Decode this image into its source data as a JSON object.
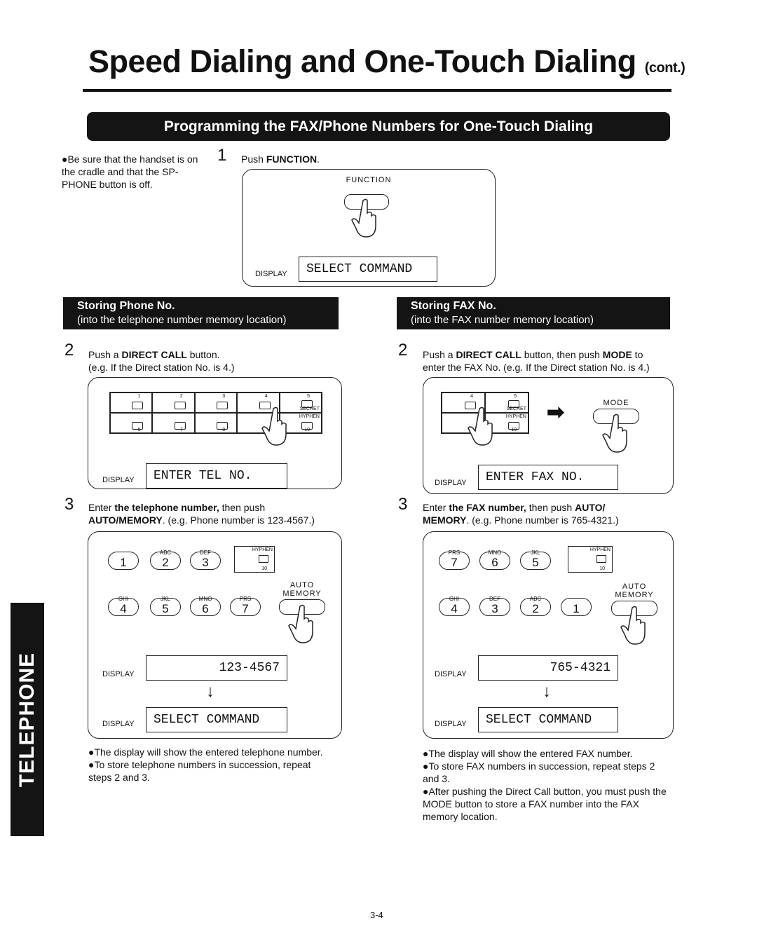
{
  "title": {
    "main": "Speed Dialing and One-Touch Dialing",
    "suffix": "(cont.)"
  },
  "banner": "Programming the FAX/Phone Numbers for One-Touch Dialing",
  "note": "●Be sure that the handset is on the cradle and that the SP-PHONE button is off.",
  "step1": {
    "number": "1",
    "text_pre": "Push ",
    "text_bold": "FUNCTION",
    "text_post": ".",
    "button_label": "FUNCTION",
    "display_label": "DISPLAY",
    "display": "SELECT COMMAND"
  },
  "phone": {
    "header_title": "Storing Phone No.",
    "header_sub": "(into the telephone number memory location)",
    "step2": {
      "number": "2",
      "line1_pre": "Push a ",
      "line1_bold": "DIRECT CALL",
      "line1_post": " button.",
      "line2": "(e.g. If the Direct station No. is 4.)",
      "display": "ENTER TEL NO."
    },
    "step3": {
      "number": "3",
      "line1_pre": "Enter ",
      "line1_bold": "the telephone number,",
      "line1_post": " then push",
      "line2_bold": "AUTO/MEMORY",
      "line2_post": ". (e.g. Phone number is 123-4567.)",
      "display1": "123-4567",
      "display2": "SELECT COMMAND"
    },
    "notes": [
      "●The display will show the entered telephone number.",
      "●To store telephone numbers in succession, repeat steps 2 and 3."
    ]
  },
  "fax": {
    "header_title": "Storing FAX No.",
    "header_sub": "(into the FAX number memory location)",
    "step2": {
      "number": "2",
      "line1_pre": "Push a ",
      "line1_bold": "DIRECT CALL",
      "line1_mid": " button, then push ",
      "line1_bold2": "MODE",
      "line1_post": " to",
      "line2": "enter the FAX No. (e.g. If the Direct station No. is 4.)",
      "mode_label": "MODE",
      "display": "ENTER FAX NO."
    },
    "step3": {
      "number": "3",
      "line1_pre": "Enter ",
      "line1_bold": "the FAX number,",
      "line1_post": " then push ",
      "line1_bold2": "AUTO/",
      "line2_bold": "MEMORY",
      "line2_post": ". (e.g. Phone number is 765-4321.)",
      "display1": "765-4321",
      "display2": "SELECT COMMAND"
    },
    "notes": [
      "●The display will show the entered FAX number.",
      "●To store FAX numbers in succession, repeat steps 2 and 3.",
      "●After pushing the Direct Call button, you must push the MODE button to store a FAX number into the FAX memory location."
    ]
  },
  "display_label": "DISPLAY",
  "auto_memory": "AUTO MEMORY",
  "hyphen": "HYPHEN",
  "secret": "SECRET",
  "ten": "10",
  "direct_keys": [
    "1",
    "2",
    "3",
    "4",
    "5",
    "6",
    "7",
    "8",
    "9",
    "10"
  ],
  "phone_keys_row1": [
    {
      "d": "1",
      "l": ""
    },
    {
      "d": "2",
      "l": "ABC"
    },
    {
      "d": "3",
      "l": "DEF"
    }
  ],
  "phone_keys_row2": [
    {
      "d": "4",
      "l": "GHI"
    },
    {
      "d": "5",
      "l": "JKL"
    },
    {
      "d": "6",
      "l": "MNO"
    },
    {
      "d": "7",
      "l": "PRS"
    }
  ],
  "fax_keys_row1": [
    {
      "d": "7",
      "l": "PRS"
    },
    {
      "d": "6",
      "l": "MNO"
    },
    {
      "d": "5",
      "l": "JKL"
    }
  ],
  "fax_keys_row2": [
    {
      "d": "4",
      "l": "GHI"
    },
    {
      "d": "3",
      "l": "DEF"
    },
    {
      "d": "2",
      "l": "ABC"
    },
    {
      "d": "1",
      "l": ""
    }
  ],
  "side_tab": "TELEPHONE",
  "page_number": "3-4"
}
